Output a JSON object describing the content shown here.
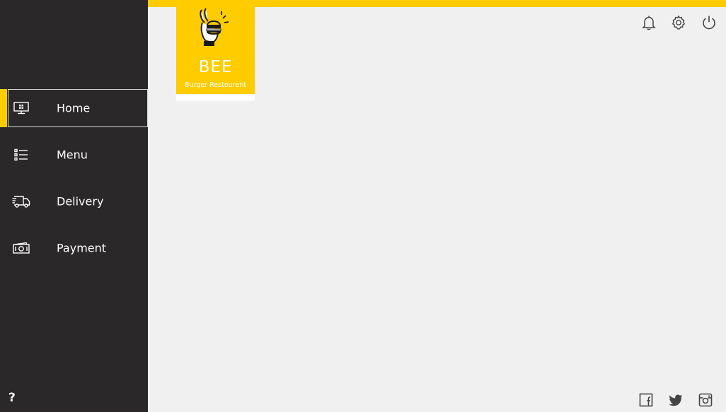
{
  "brand": {
    "name": "BEE",
    "tagline": "Burger Restourent",
    "logo_icon": "hand-holding-burger-icon",
    "accent_color": "#ffcc00",
    "sidebar_color": "#2a2828",
    "content_bg": "#f0f0f0"
  },
  "sidebar": {
    "items": [
      {
        "label": "Home",
        "icon": "monitor-icon",
        "active": true
      },
      {
        "label": "Menu",
        "icon": "list-icon",
        "active": false
      },
      {
        "label": "Delivery",
        "icon": "delivery-truck-icon",
        "active": false
      },
      {
        "label": "Payment",
        "icon": "cash-icon",
        "active": false
      }
    ],
    "help_label": "?"
  },
  "header": {
    "icons": [
      "bell-icon",
      "gear-icon",
      "power-icon"
    ]
  },
  "footer": {
    "social_icons": [
      "facebook-icon",
      "twitter-icon",
      "instagram-icon"
    ]
  }
}
